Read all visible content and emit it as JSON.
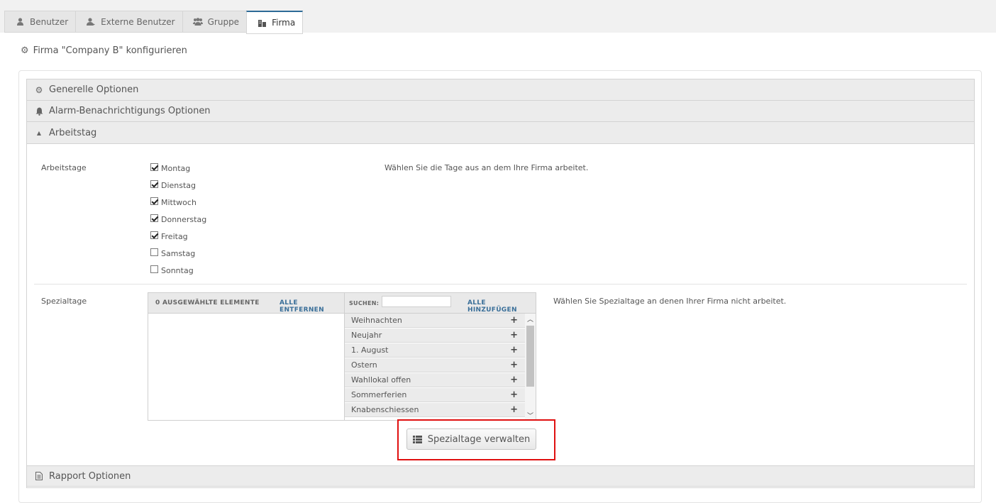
{
  "tabs": [
    {
      "label": "Benutzer",
      "icon": "user-icon",
      "active": false
    },
    {
      "label": "Externe Benutzer",
      "icon": "external-user-icon",
      "active": false
    },
    {
      "label": "Gruppe",
      "icon": "group-icon",
      "active": false
    },
    {
      "label": "Firma",
      "icon": "building-icon",
      "active": true
    }
  ],
  "page": {
    "title": "Firma \"Company B\" konfigurieren",
    "title_icon": "cogs-icon"
  },
  "sections": {
    "general": {
      "label": "Generelle Optionen",
      "icon": "cogs-icon"
    },
    "alarm": {
      "label": "Alarm-Benachrichtigungs Optionen",
      "icon": "bell-icon"
    },
    "workday": {
      "label": "Arbeitstag",
      "icon": "caret-up-icon"
    },
    "report": {
      "label": "Rapport Optionen",
      "icon": "document-icon"
    }
  },
  "workdays": {
    "label": "Arbeitstage",
    "description": "Wählen Sie die Tage aus an dem Ihre Firma arbeitet.",
    "days": [
      {
        "label": "Montag",
        "checked": true
      },
      {
        "label": "Dienstag",
        "checked": true
      },
      {
        "label": "Mittwoch",
        "checked": true
      },
      {
        "label": "Donnerstag",
        "checked": true
      },
      {
        "label": "Freitag",
        "checked": true
      },
      {
        "label": "Samstag",
        "checked": false
      },
      {
        "label": "Sonntag",
        "checked": false
      }
    ]
  },
  "special_days": {
    "label": "Spezialtage",
    "description": "Wählen Sie Spezialtage an denen Ihrer Firma nicht arbeitet.",
    "selected_count_label": "0 AUSGEWÄHLTE ELEMENTE",
    "remove_all_label": "ALLE ENTFERNEN",
    "search_label": "SUCHEN:",
    "search_value": "",
    "add_all_label": "ALLE HINZUFÜGEN",
    "available": [
      "Weihnachten",
      "Neujahr",
      "1. August",
      "Ostern",
      "Wahllokal offen",
      "Sommerferien",
      "Knabenschiessen"
    ],
    "manage_button_label": "Spezialtage verwalten"
  },
  "colors": {
    "accent": "#2d6a97",
    "highlight_box": "#e01010"
  }
}
